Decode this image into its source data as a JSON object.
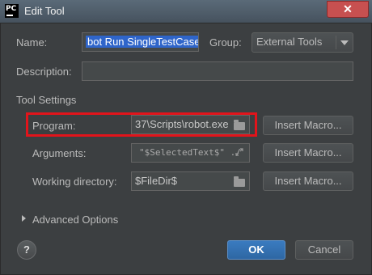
{
  "window": {
    "app_icon_text": "PC",
    "title": "Edit Tool",
    "close_label": "✕"
  },
  "name": {
    "label": "Name:",
    "value": "bot Run SingleTestCase"
  },
  "group": {
    "label": "Group:",
    "value": "External Tools"
  },
  "description": {
    "label": "Description:",
    "value": ""
  },
  "tool_settings": {
    "section_label": "Tool Settings",
    "program": {
      "label": "Program:",
      "value": "37\\Scripts\\robot.exe"
    },
    "arguments": {
      "label": "Arguments:",
      "value": "\"$SelectedText$\" ./"
    },
    "working_directory": {
      "label": "Working directory:",
      "value": "$FileDir$"
    },
    "insert_macro_label": "Insert Macro..."
  },
  "advanced_options": {
    "label": "Advanced Options"
  },
  "buttons": {
    "help": "?",
    "ok": "OK",
    "cancel": "Cancel"
  },
  "colors": {
    "highlight_border": "#e2141b",
    "ok_button": "#3574b8",
    "close_button": "#c75050"
  }
}
